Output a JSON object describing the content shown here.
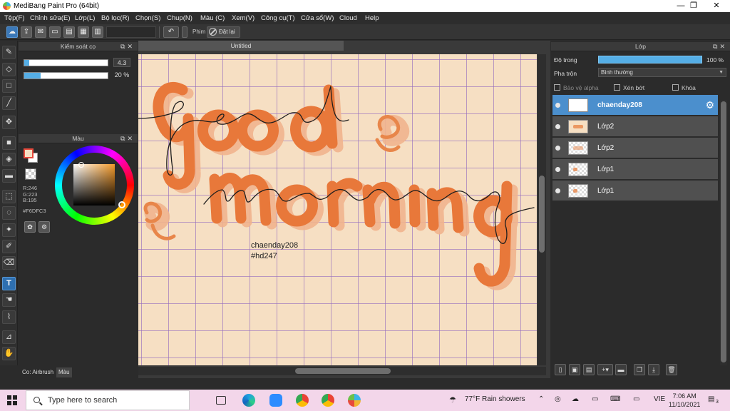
{
  "window": {
    "title": "MediBang Paint Pro (64bit)",
    "controls": [
      "—",
      "❐",
      "✕"
    ]
  },
  "menu": [
    "Tệp(F)",
    "Chỉnh sửa(E)",
    "Lớp(L)",
    "Bộ lọc(R)",
    "Chọn(S)",
    "Chup(N)",
    "Màu (C)",
    "Xem(V)",
    "Công cụ(T)",
    "Cửa sổ(W)",
    "Cloud",
    "Help"
  ],
  "toolbar": {
    "undo_icon": "undo-icon",
    "shortcut_label": "Phim",
    "reset_label": "Đặt lại"
  },
  "brush_panel": {
    "title": "Kiểm soát cọ",
    "size_value": "4.3",
    "size_level": 0.06,
    "opacity_value": "20 %",
    "opacity_level": 0.2
  },
  "color_panel": {
    "title": "Màu",
    "r": "R:246",
    "g": "G:223",
    "b": "B:195",
    "hex": "#F6DFC3",
    "fg_color": "#f6dfc3"
  },
  "bottom_tabs": {
    "brush_tab": "Co: Airbrush",
    "color_tab": "Màu"
  },
  "document": {
    "tab": "Untitled",
    "canvas_color": "#f6dfc3",
    "watermark_line1": "chaenday208",
    "watermark_line2": "#hd247"
  },
  "layer_panel": {
    "title": "Lớp",
    "opacity_label": "Độ trong",
    "opacity_value": "100 %",
    "blend_label": "Pha trộn",
    "blend_value": "Bình thường",
    "protect_alpha": "Bảo vệ alpha",
    "clipping": "Xén bớt",
    "lock": "Khóa",
    "layers": [
      {
        "name": "chaenday208",
        "selected": true
      },
      {
        "name": "Lớp2",
        "selected": false
      },
      {
        "name": "Lớp2",
        "selected": false
      },
      {
        "name": "Lớp1",
        "selected": false
      },
      {
        "name": "Lớp1",
        "selected": false
      }
    ]
  },
  "taskbar": {
    "search_placeholder": "Type here to search",
    "weather": "77°F  Rain showers",
    "lang": "VIE",
    "time": "7:06 AM",
    "date": "11/10/2021",
    "notifications": "3"
  }
}
